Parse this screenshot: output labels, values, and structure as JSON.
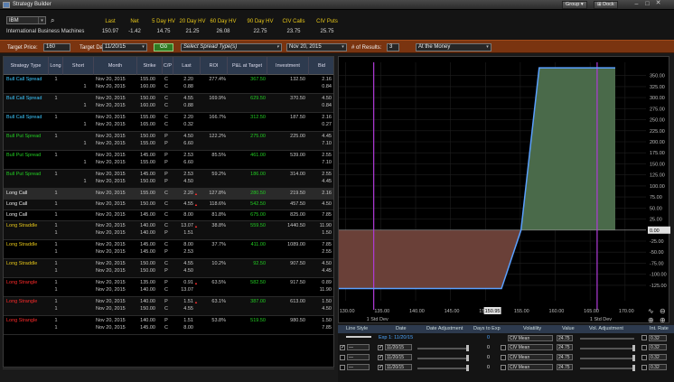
{
  "window": {
    "title": "Strategy Builder",
    "group_label": "Group",
    "dock_label": "Dock"
  },
  "quote": {
    "symbol": "IBM",
    "company": "International Business Machines",
    "headers": [
      "Last",
      "Net",
      "5 Day HV",
      "20 Day HV",
      "60 Day HV",
      "90 Day HV",
      "CIV Calls",
      "CIV Puts"
    ],
    "values": [
      "150.97",
      "-1.42",
      "14.75",
      "21.25",
      "26.08",
      "22.75",
      "23.75",
      "25.75"
    ]
  },
  "toolbar": {
    "target_price_label": "Target Price:",
    "target_price": "160",
    "target_date_label": "Target Date:",
    "target_date": "11/20/15",
    "go_label": "Go",
    "spread_type": "Select Spread Type(s)",
    "expiration": "Nov 20, 2015",
    "results_label": "# of Results:",
    "results": "3",
    "moneyness": "At the Money"
  },
  "grid": {
    "columns": [
      "Strategy Type",
      "Long",
      "Short",
      "Month",
      "Strike",
      "C/P",
      "Last",
      "ROI",
      "P&L at Target",
      "Investment",
      "Bid"
    ],
    "rows": [
      {
        "name": "Bull Call Spread",
        "color": "#3cc8ff",
        "long": [
          "1",
          ""
        ],
        "short": [
          "",
          "1"
        ],
        "month": [
          "Nov 20, 2015",
          "Nov 20, 2015"
        ],
        "strike": [
          "155.00",
          "160.00"
        ],
        "cp": [
          "C",
          "C"
        ],
        "last": [
          "2.20",
          "0.88"
        ],
        "roi": "277.4%",
        "pl": "367.50",
        "inv": "132.50",
        "bid": [
          "2.16",
          "0.84"
        ],
        "flag": false
      },
      {
        "name": "Bull Call Spread",
        "color": "#3cc8ff",
        "long": [
          "1",
          ""
        ],
        "short": [
          "",
          "1"
        ],
        "month": [
          "Nov 20, 2015",
          "Nov 20, 2015"
        ],
        "strike": [
          "150.00",
          "160.00"
        ],
        "cp": [
          "C",
          "C"
        ],
        "last": [
          "4.55",
          "0.88"
        ],
        "roi": "169.9%",
        "pl": "629.50",
        "inv": "370.50",
        "bid": [
          "4.50",
          "0.84"
        ],
        "flag": false
      },
      {
        "name": "Bull Call Spread",
        "color": "#3cc8ff",
        "long": [
          "1",
          ""
        ],
        "short": [
          "",
          "1"
        ],
        "month": [
          "Nov 20, 2015",
          "Nov 20, 2015"
        ],
        "strike": [
          "155.00",
          "165.00"
        ],
        "cp": [
          "C",
          "C"
        ],
        "last": [
          "2.20",
          "0.32"
        ],
        "roi": "166.7%",
        "pl": "312.50",
        "inv": "187.50",
        "bid": [
          "2.16",
          "0.27"
        ],
        "flag": false
      },
      {
        "name": "Bull Put Spread",
        "color": "#22cc22",
        "long": [
          "1",
          ""
        ],
        "short": [
          "",
          "1"
        ],
        "month": [
          "Nov 20, 2015",
          "Nov 20, 2015"
        ],
        "strike": [
          "150.00",
          "155.00"
        ],
        "cp": [
          "P",
          "P"
        ],
        "last": [
          "4.50",
          "6.60"
        ],
        "roi": "122.2%",
        "pl": "275.00",
        "inv": "225.00",
        "bid": [
          "4.45",
          "7.10"
        ],
        "flag": false
      },
      {
        "name": "Bull Put Spread",
        "color": "#22cc22",
        "long": [
          "1",
          ""
        ],
        "short": [
          "",
          "1"
        ],
        "month": [
          "Nov 20, 2015",
          "Nov 20, 2015"
        ],
        "strike": [
          "145.00",
          "155.00"
        ],
        "cp": [
          "P",
          "P"
        ],
        "last": [
          "2.53",
          "6.60"
        ],
        "roi": "85.5%",
        "pl": "461.00",
        "inv": "539.00",
        "bid": [
          "2.55",
          "7.10"
        ],
        "flag": false
      },
      {
        "name": "Bull Put Spread",
        "color": "#22cc22",
        "long": [
          "1",
          ""
        ],
        "short": [
          "",
          "1"
        ],
        "month": [
          "Nov 20, 2015",
          "Nov 20, 2015"
        ],
        "strike": [
          "145.00",
          "150.00"
        ],
        "cp": [
          "P",
          "P"
        ],
        "last": [
          "2.53",
          "4.50"
        ],
        "roi": "59.2%",
        "pl": "186.00",
        "inv": "314.00",
        "bid": [
          "2.55",
          "4.45"
        ],
        "flag": false
      },
      {
        "name": "Long Call",
        "color": "#e8e8e8",
        "long": [
          "1"
        ],
        "short": [
          ""
        ],
        "month": [
          "Nov 20, 2015"
        ],
        "strike": [
          "155.00"
        ],
        "cp": [
          "C"
        ],
        "last": [
          "2.20"
        ],
        "roi": "127.8%",
        "pl": "280.50",
        "inv": "219.50",
        "bid": [
          "2.16"
        ],
        "flag": true
      },
      {
        "name": "Long Call",
        "color": "#e8e8e8",
        "long": [
          "1"
        ],
        "short": [
          ""
        ],
        "month": [
          "Nov 20, 2015"
        ],
        "strike": [
          "150.00"
        ],
        "cp": [
          "C"
        ],
        "last": [
          "4.55"
        ],
        "roi": "118.6%",
        "pl": "542.50",
        "inv": "457.50",
        "bid": [
          "4.50"
        ],
        "flag": true
      },
      {
        "name": "Long Call",
        "color": "#e8e8e8",
        "long": [
          "1"
        ],
        "short": [
          ""
        ],
        "month": [
          "Nov 20, 2015"
        ],
        "strike": [
          "145.00"
        ],
        "cp": [
          "C"
        ],
        "last": [
          "8.00"
        ],
        "roi": "81.8%",
        "pl": "675.00",
        "inv": "825.00",
        "bid": [
          "7.85"
        ],
        "flag": false
      },
      {
        "name": "Long Straddle",
        "color": "#e6c619",
        "long": [
          "1",
          "1"
        ],
        "short": [
          "",
          ""
        ],
        "month": [
          "Nov 20, 2015",
          "Nov 20, 2015"
        ],
        "strike": [
          "140.00",
          "140.00"
        ],
        "cp": [
          "C",
          "P"
        ],
        "last": [
          "13.07",
          "1.51"
        ],
        "roi": "38.8%",
        "pl": "559.50",
        "inv": "1440.50",
        "bid": [
          "11.90",
          "1.50"
        ],
        "flag": true
      },
      {
        "name": "Long Straddle",
        "color": "#e6c619",
        "long": [
          "1",
          "1"
        ],
        "short": [
          "",
          ""
        ],
        "month": [
          "Nov 20, 2015",
          "Nov 20, 2015"
        ],
        "strike": [
          "145.00",
          "145.00"
        ],
        "cp": [
          "C",
          "P"
        ],
        "last": [
          "8.00",
          "2.53"
        ],
        "roi": "37.7%",
        "pl": "411.00",
        "inv": "1089.00",
        "bid": [
          "7.85",
          "2.55"
        ],
        "flag": false
      },
      {
        "name": "Long Straddle",
        "color": "#e6c619",
        "long": [
          "1",
          "1"
        ],
        "short": [
          "",
          ""
        ],
        "month": [
          "Nov 20, 2015",
          "Nov 20, 2015"
        ],
        "strike": [
          "150.00",
          "150.00"
        ],
        "cp": [
          "C",
          "P"
        ],
        "last": [
          "4.55",
          "4.50"
        ],
        "roi": "10.2%",
        "pl": "92.50",
        "inv": "907.50",
        "bid": [
          "4.50",
          "4.45"
        ],
        "flag": false
      },
      {
        "name": "Long Strangle",
        "color": "#ff2a2a",
        "long": [
          "1",
          "1"
        ],
        "short": [
          "",
          ""
        ],
        "month": [
          "Nov 20, 2015",
          "Nov 20, 2015"
        ],
        "strike": [
          "135.00",
          "140.00"
        ],
        "cp": [
          "P",
          "C"
        ],
        "last": [
          "0.91",
          "13.07"
        ],
        "roi": "63.5%",
        "pl": "582.50",
        "inv": "917.50",
        "bid": [
          "0.89",
          "11.90"
        ],
        "flag": true
      },
      {
        "name": "Long Strangle",
        "color": "#ff2a2a",
        "long": [
          "1",
          "1"
        ],
        "short": [
          "",
          ""
        ],
        "month": [
          "Nov 20, 2015",
          "Nov 20, 2015"
        ],
        "strike": [
          "140.00",
          "150.00"
        ],
        "cp": [
          "P",
          "C"
        ],
        "last": [
          "1.51",
          "4.55"
        ],
        "roi": "63.1%",
        "pl": "387.00",
        "inv": "613.00",
        "bid": [
          "1.50",
          "4.50"
        ],
        "flag": true
      },
      {
        "name": "Long Strangle",
        "color": "#ff2a2a",
        "long": [
          "1",
          "1"
        ],
        "short": [
          "",
          ""
        ],
        "month": [
          "Nov 20, 2015",
          "Nov 20, 2015"
        ],
        "strike": [
          "140.00",
          "145.00"
        ],
        "cp": [
          "P",
          "C"
        ],
        "last": [
          "1.51",
          "8.00"
        ],
        "roi": "53.8%",
        "pl": "519.50",
        "inv": "980.50",
        "bid": [
          "1.50",
          "7.85"
        ],
        "flag": false
      }
    ]
  },
  "chart_data": {
    "type": "line",
    "x": [
      129,
      152.3,
      155.1,
      157.7,
      168.6
    ],
    "y": [
      -132.5,
      -132.5,
      0,
      367.5,
      367.5
    ],
    "xlim": [
      129,
      173
    ],
    "ylim": [
      -160,
      380
    ],
    "xticks": [
      "130.00",
      "135.00",
      "140.00",
      "145.00",
      "150.00",
      "155.00",
      "160.00",
      "165.00",
      "170.00"
    ],
    "yticks": [
      "350.00",
      "325.00",
      "300.00",
      "275.00",
      "250.00",
      "225.00",
      "200.00",
      "175.00",
      "150.00",
      "125.00",
      "100.00",
      "75.00",
      "50.00",
      "25.00",
      "0.00",
      "-25.00",
      "-50.00",
      "-75.00",
      "-100.00",
      "-125.00"
    ],
    "current_price": "150.95",
    "zero_label": "0.00",
    "std_lines": [
      134,
      166
    ],
    "std_labels": [
      "1 Std Dev",
      "1 Std Dev"
    ],
    "profit_color": "#4a6a4a",
    "loss_color": "#6a4038",
    "line_color": "#5aa0ff"
  },
  "lower": {
    "headers": [
      "Line Style",
      "Date",
      "Date Adjustment",
      "Days to Exp",
      "Volatility",
      "Value",
      "Vol. Adjustment",
      "Int. Rate"
    ],
    "exp_label": "Exp 1: 11/20/15",
    "days_blue": "0",
    "rows": [
      {
        "checked": true,
        "date": "11/20/15",
        "days": "0",
        "vol": "CIV Mean",
        "value": "24.75",
        "rate": "0.32"
      },
      {
        "checked": false,
        "date": "11/20/15",
        "days": "0",
        "vol": "CIV Mean",
        "value": "24.75",
        "rate": "0.32"
      },
      {
        "checked": false,
        "date": "11/20/15",
        "days": "0",
        "vol": "CIV Mean",
        "value": "24.75",
        "rate": "0.32"
      }
    ],
    "top_row": {
      "vol": "CIV Mean",
      "value": "24.75",
      "rate": "0.32"
    }
  }
}
